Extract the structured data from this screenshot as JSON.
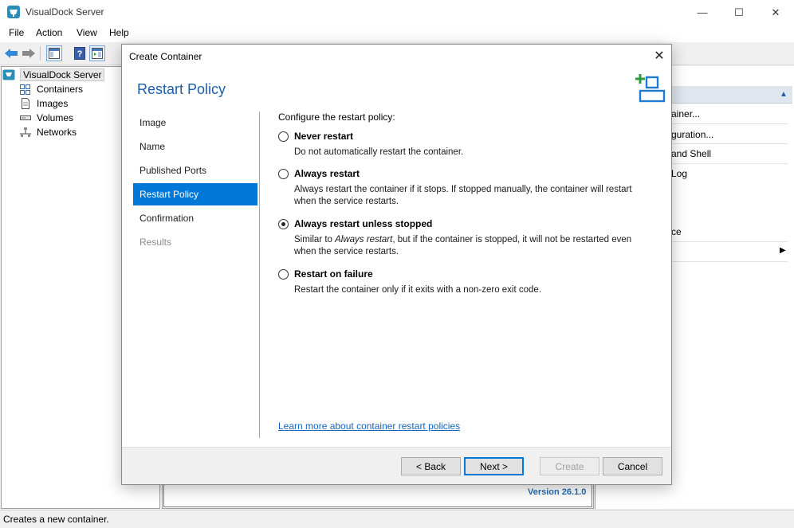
{
  "app": {
    "title": "VisualDock Server",
    "menu": [
      "File",
      "Action",
      "View",
      "Help"
    ],
    "icon": "whale-icon",
    "window_buttons": {
      "minimize": "—",
      "maximize": "☐",
      "close": "✕"
    }
  },
  "tree": {
    "root": "VisualDock Server",
    "items": [
      "Containers",
      "Images",
      "Volumes",
      "Networks"
    ]
  },
  "actions": {
    "items": [
      "ainer...",
      "guration...",
      "and Shell",
      "Log",
      "ce"
    ]
  },
  "center": {
    "version": "Version 26.1.0"
  },
  "status": {
    "text": "Creates a new container."
  },
  "dialog": {
    "title": "Create Container",
    "close_glyph": "✕",
    "heading": "Restart Policy",
    "steps": [
      {
        "label": "Image",
        "state": "normal"
      },
      {
        "label": "Name",
        "state": "normal"
      },
      {
        "label": "Published Ports",
        "state": "normal"
      },
      {
        "label": "Restart Policy",
        "state": "active"
      },
      {
        "label": "Confirmation",
        "state": "normal"
      },
      {
        "label": "Results",
        "state": "disabled"
      }
    ],
    "prompt": "Configure the restart policy:",
    "options": [
      {
        "label": "Never restart",
        "desc": "Do not automatically restart the container.",
        "checked": false
      },
      {
        "label": "Always restart",
        "desc": "Always restart the container if it stops. If stopped manually, the container will restart when the service restarts.",
        "checked": false
      },
      {
        "label": "Always restart unless stopped",
        "desc_prefix": "Similar to ",
        "desc_em": "Always restart",
        "desc_suffix": ", but if the container is stopped, it will not be restarted even when the service restarts.",
        "checked": true
      },
      {
        "label": "Restart on failure",
        "desc": "Restart the container only if it exits with a non-zero exit code.",
        "checked": false
      }
    ],
    "learn_more": "Learn more about container restart policies",
    "buttons": {
      "back": "< Back",
      "next": "Next >",
      "create": "Create",
      "cancel": "Cancel"
    }
  },
  "colors": {
    "accent": "#0078d7",
    "heading": "#1d5fa8",
    "link": "#1565c0",
    "logo_green": "#2e9b3a",
    "logo_blue": "#1e7bd0"
  }
}
